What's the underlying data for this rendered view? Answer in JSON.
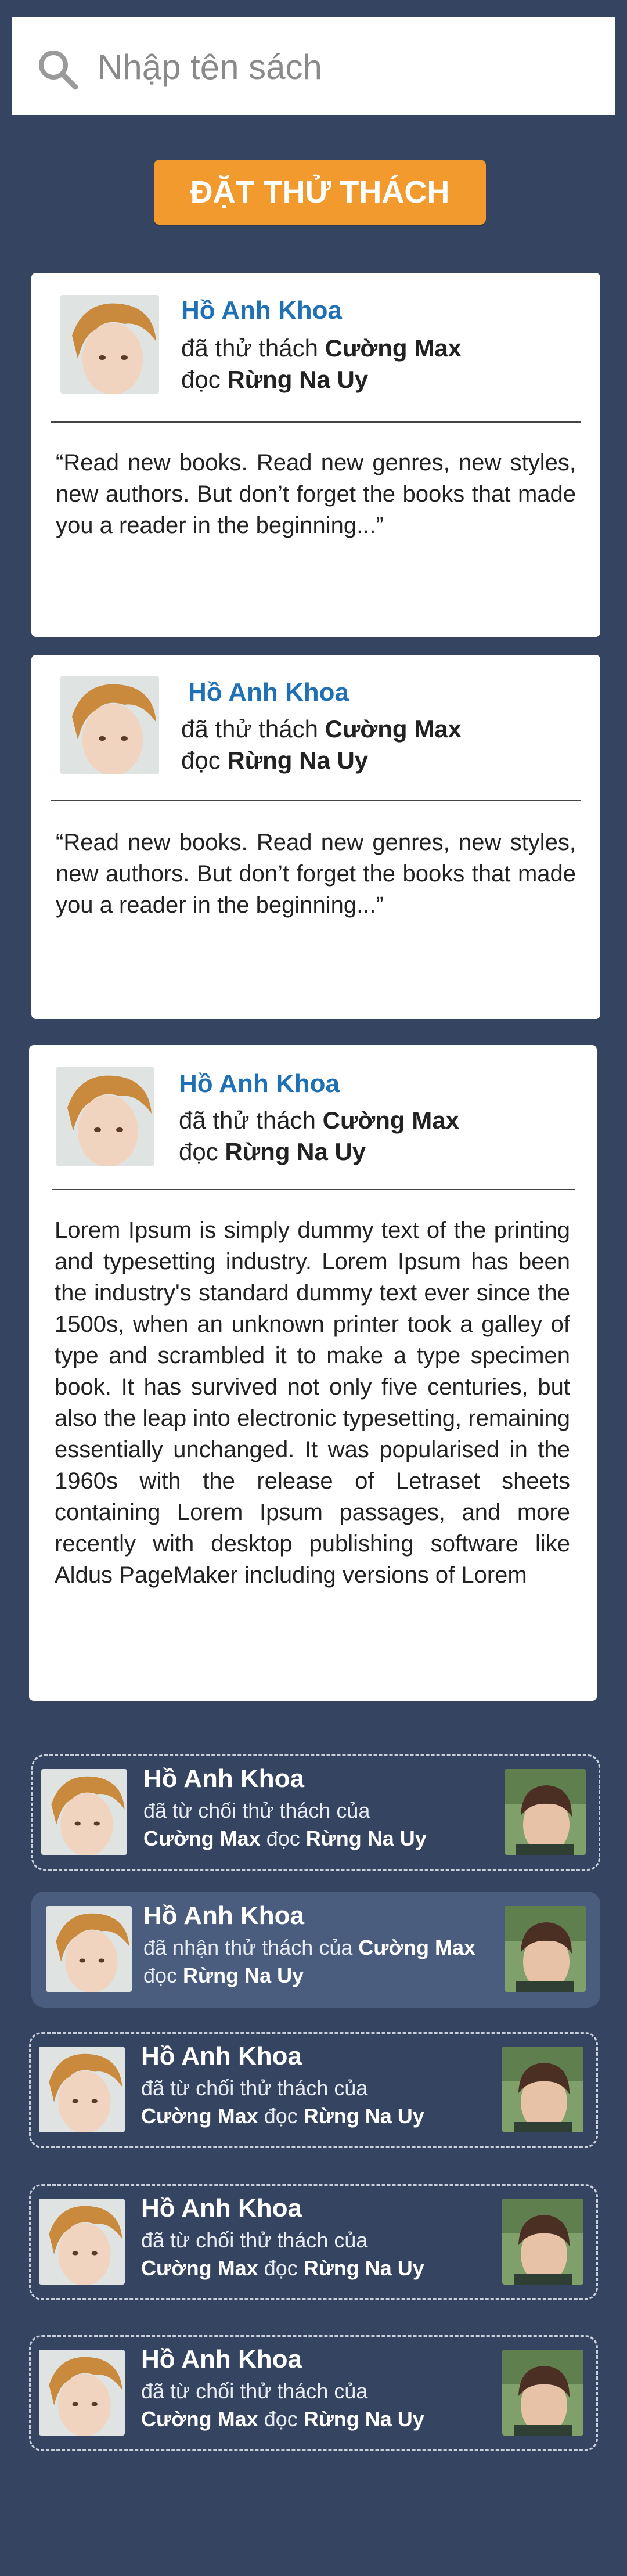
{
  "search": {
    "placeholder": "Nhập tên sách"
  },
  "challenge_button": {
    "label": "ĐẶT THỬ THÁCH"
  },
  "feed": [
    {
      "user": "Hồ Anh Khoa",
      "prefix1": "đã thử thách ",
      "target": "Cường Max",
      "prefix2": "đọc ",
      "book": "Rừng Na Uy",
      "text": "“Read new books. Read new genres, new styles, new authors. But don’t forget the books that made you a reader in the beginning...”"
    },
    {
      "user": "Hồ Anh Khoa",
      "prefix1": "đã thử thách ",
      "target": "Cường Max",
      "prefix2": "đọc ",
      "book": "Rừng Na Uy",
      "text": "“Read new books. Read new genres, new styles, new authors. But don’t forget the books that made you a reader in the beginning...”"
    },
    {
      "user": "Hồ Anh Khoa",
      "prefix1": "đã thử thách ",
      "target": "Cường Max",
      "prefix2": "đọc ",
      "book": "Rừng Na Uy",
      "text": "Lorem Ipsum is simply dummy text of the printing and typesetting industry. Lorem Ipsum has been the industry's standard dummy text ever since the 1500s, when an unknown printer took a galley of type and scrambled it to make a type specimen book. It has survived not only five centuries, but also the leap into electronic typesetting, remaining essentially unchanged. It was popularised in the 1960s with the release of Letraset sheets containing Lorem Ipsum passages, and more recently with desktop publishing software like Aldus PageMaker including versions of Lorem"
    }
  ],
  "notifications": [
    {
      "user": "Hồ Anh Khoa",
      "action": "đã từ chối thử thách của",
      "target": "Cường Max",
      "mid": " đọc ",
      "book": "Rừng Na Uy",
      "style": "dashed"
    },
    {
      "user": "Hồ Anh Khoa",
      "action": "đã nhận thử thách của ",
      "target": "Cường Max",
      "mid": "đọc ",
      "book": "Rừng Na Uy",
      "style": "filled"
    },
    {
      "user": "Hồ Anh Khoa",
      "action": "đã từ chối thử thách của",
      "target": "Cường Max",
      "mid": " đọc ",
      "book": "Rừng Na Uy",
      "style": "dashed"
    },
    {
      "user": "Hồ Anh Khoa",
      "action": "đã từ chối thử thách của",
      "target": "Cường Max",
      "mid": " đọc ",
      "book": "Rừng Na Uy",
      "style": "dashed"
    },
    {
      "user": "Hồ Anh Khoa",
      "action": "đã từ chối thử thách của",
      "target": "Cường Max",
      "mid": " đọc ",
      "book": "Rừng Na Uy",
      "style": "dashed"
    }
  ],
  "colors": {
    "background": "#354460",
    "accent": "#f29a2e",
    "name_blue": "#1f70b5",
    "highlight_card": "#4a5d7e"
  }
}
